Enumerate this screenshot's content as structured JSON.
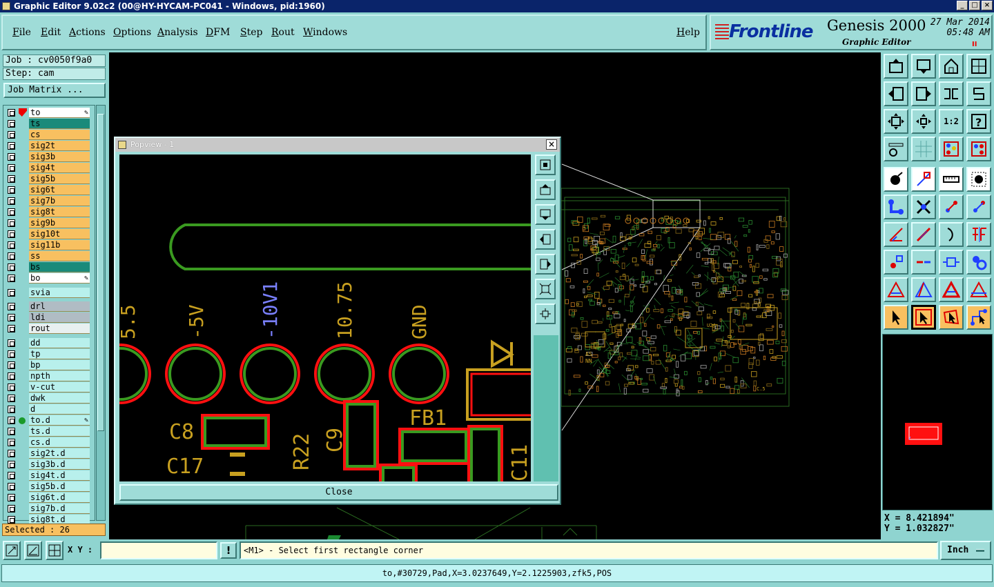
{
  "window": {
    "title": "Graphic Editor 9.02c2 (00@HY-HYCAM-PC041 - Windows, pid:1960)"
  },
  "menu": [
    "File",
    "Edit",
    "Actions",
    "Options",
    "Analysis",
    "DFM",
    "Step",
    "Rout",
    "Windows"
  ],
  "help": "Help",
  "brand": {
    "logo": "Frontline",
    "product": "Genesis 2000",
    "subtitle": "Graphic Editor",
    "date": "27 Mar 2014",
    "time": "05:48 AM",
    "pause": "II"
  },
  "job": {
    "job_label": "Job : cv0050f9a0",
    "step_label": "Step: cam",
    "job_matrix": "Job Matrix ..."
  },
  "layers_board": [
    "to",
    "ts",
    "cs",
    "sig2t",
    "sig3b",
    "sig4t",
    "sig5b",
    "sig6t",
    "sig7b",
    "sig8t",
    "sig9b",
    "sig10t",
    "sig11b",
    "ss",
    "bs",
    "bo"
  ],
  "layers_drill": [
    "svia",
    "drl",
    "ldi",
    "rout"
  ],
  "layers_misc": [
    "dd",
    "tp",
    "bp",
    "npth",
    "v-cut",
    "dwk",
    "d",
    "to.d",
    "ts.d",
    "cs.d",
    "sig2t.d",
    "sig3b.d",
    "sig4t.d",
    "sig5b.d",
    "sig6t.d",
    "sig7b.d",
    "sig8t.d"
  ],
  "selected": "Selected : 26",
  "popview": {
    "title": "Popview - 1",
    "close": "Close",
    "pad_labels": [
      "5.5",
      "-5V",
      "-10V1",
      "10.75",
      "GND"
    ],
    "ref_labels": [
      "C8",
      "C17",
      "R22",
      "C9",
      "FB1",
      "C11"
    ]
  },
  "coords": {
    "x": "X = 8.421894\"",
    "y": "Y = 1.032827\""
  },
  "bottom": {
    "xy_label": "X Y :",
    "xy_value": "",
    "bang": "!",
    "prompt": "<M1> - Select first rectangle corner",
    "units": "Inch"
  },
  "status": "to,#30729,Pad,X=3.0237649,Y=2.1225903,zfk5,POS",
  "board_labels": [
    "AS",
    "NN",
    "U24",
    "C.5"
  ],
  "colors": {
    "layer_orange": "#f8c060",
    "layer_green": "#1a8a7a",
    "layer_white": "#ffffff",
    "layer_gray": "#b0bcc4",
    "layer_cyan": "#b8f0ec",
    "pad_red": "#ff1010",
    "pad_green": "#3a9a20",
    "label_yellow": "#c8a020",
    "label_blue": "#7a80ff"
  }
}
